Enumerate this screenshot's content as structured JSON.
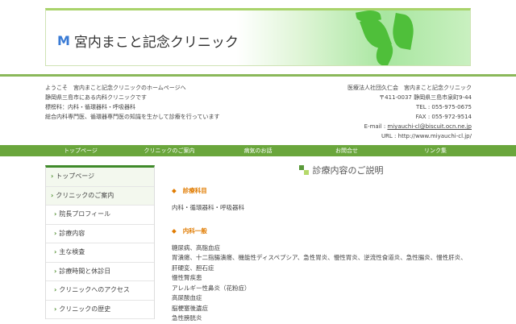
{
  "header": {
    "logo_mark": "M",
    "title": "宮内まこと記念クリニック"
  },
  "intro": [
    "ようこそ　宮内まこと記念クリニックのホームページへ",
    "静岡県三島市にある内科クリニックです",
    "標榜科：内科・循環器科・呼吸器科",
    "総合内科専門医、循環器専門医の知識を生かして診療を行っています"
  ],
  "contact": {
    "org": "医療法人社団久仁会　宮内まこと記念クリニック",
    "address": "〒411-0037 静岡県三島市泉町9-44",
    "tel": "TEL : 055-975-0675",
    "fax": "FAX : 055-972-9514",
    "email_label": "E-mail : ",
    "email": "miyauchi-cl@biscuit.ocn.ne.jp",
    "url": "URL : http://www.miyauchi-cl.jp/"
  },
  "nav": [
    "トップページ",
    "クリニックのご案内",
    "病気のお話",
    "お問合せ",
    "リンク集"
  ],
  "sidebar": {
    "top": [
      "トップページ",
      "クリニックのご案内"
    ],
    "sub": [
      "院長プロフィール",
      "診療内容",
      "主な検査",
      "診療時間と休診日",
      "クリニックへのアクセス",
      "クリニックの歴史"
    ]
  },
  "main": {
    "title": "診療内容のご説明",
    "sections": [
      {
        "heading": "診療科目",
        "lines": [
          "内科・循環器科・呼吸器科"
        ]
      },
      {
        "heading": "内科一般",
        "lines": [
          "糖尿病、高脂血症",
          "胃潰瘍、十二指腸潰瘍、機能性ディスペプシア、急性胃炎、慢性胃炎、逆流性食道炎、急性腸炎、慢性肝炎、",
          "肝硬変、胆石症",
          "慢性腎疾患",
          "アレルギー性鼻炎（花粉症）",
          "高尿酸血症",
          "脳梗塞後遺症",
          "急性膀胱炎"
        ]
      }
    ]
  },
  "colors": {
    "nav": "#6aa63c",
    "heading": "#e07b00"
  }
}
